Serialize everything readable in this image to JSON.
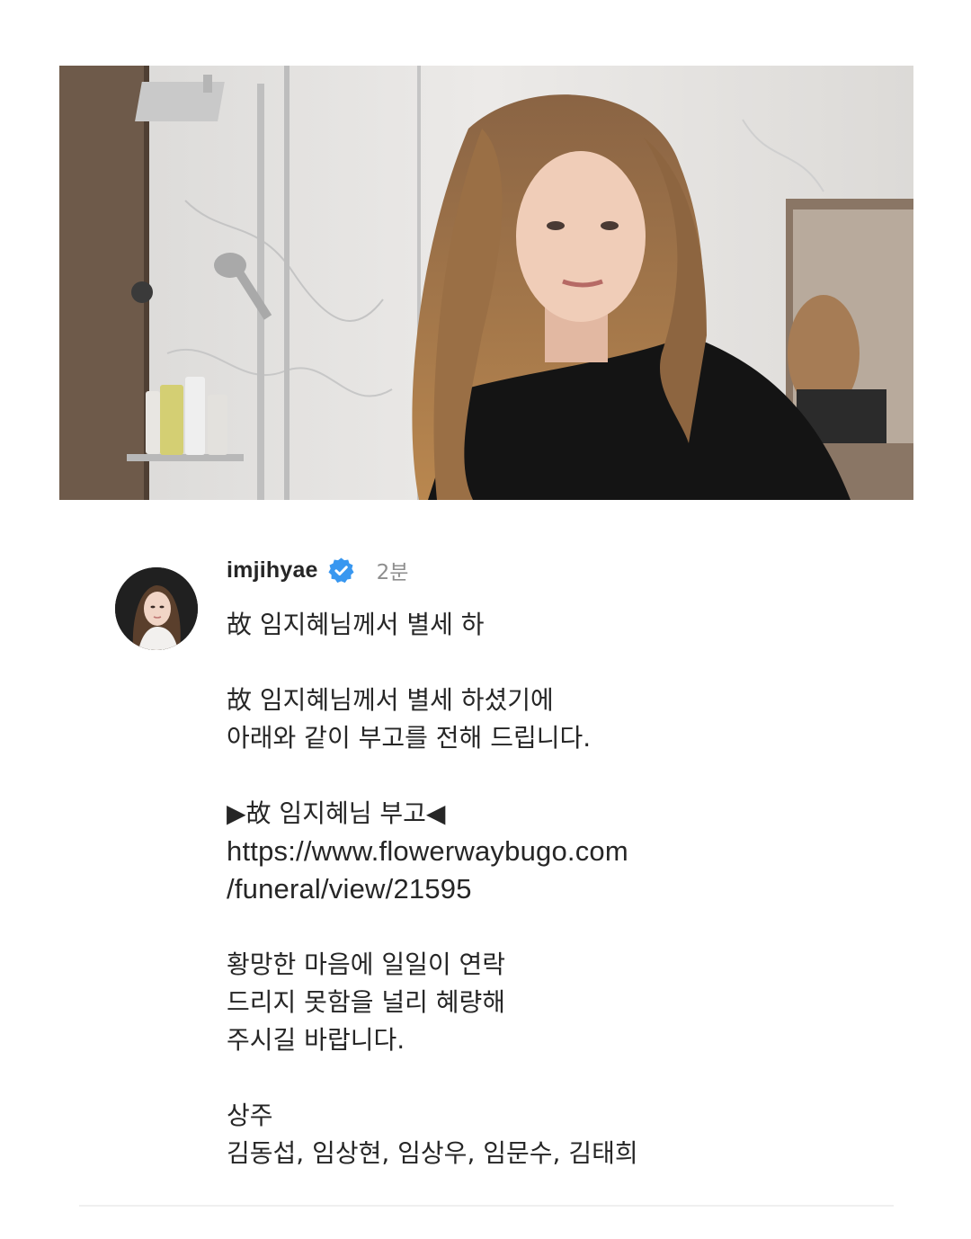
{
  "post": {
    "username": "imjihyae",
    "time_ago": "2분",
    "icons": {
      "verified": "verified-badge-icon",
      "verified_color": "#3897f0"
    },
    "caption": {
      "preview": "故 임지혜님께서 별세 하",
      "paragraph1": [
        "故 임지혜님께서 별세 하셨기에",
        "아래와 같이 부고를 전해 드립니다."
      ],
      "notice_heading": "▶故 임지혜님 부고◀",
      "link": [
        "https://www.flowerwaybugo.com",
        "/funeral/view/21595"
      ],
      "paragraph2": [
        "황망한 마음에 일일이 연락",
        "드리지 못함을 널리 혜량해",
        "주시길 바랍니다."
      ],
      "mourners_label": "상주",
      "mourners": "김동섭, 임상현, 임상우, 임문수, 김태희"
    }
  }
}
